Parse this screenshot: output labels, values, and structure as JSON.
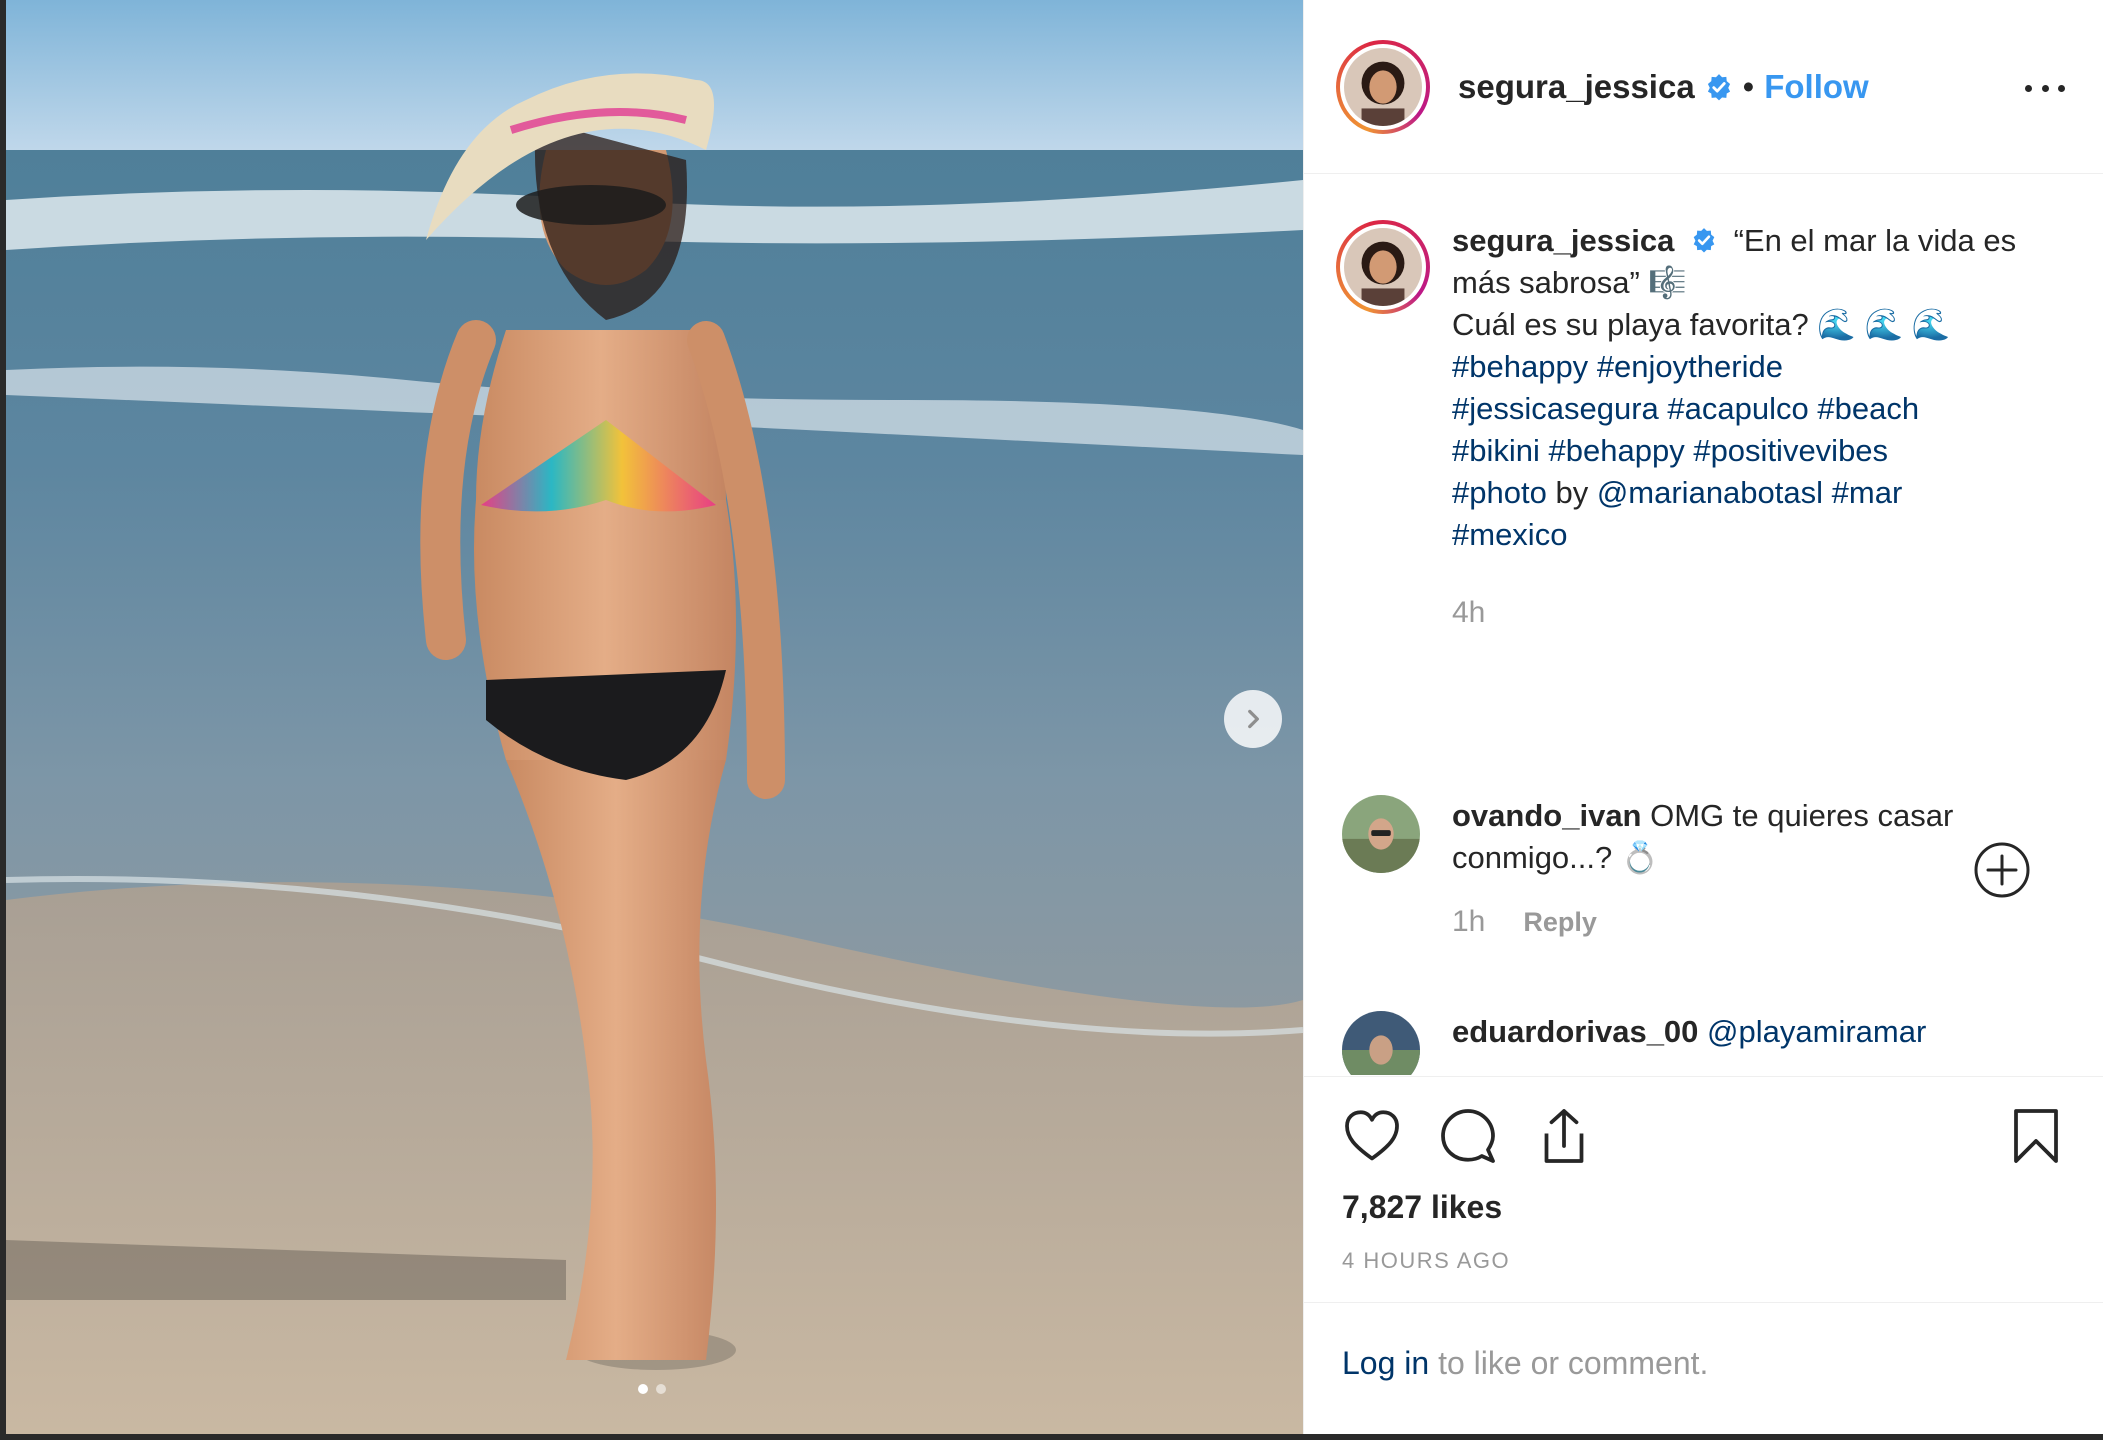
{
  "post": {
    "username": "segura_jessica",
    "separator": "•",
    "follow_label": "Follow",
    "carousel_index": 1,
    "carousel_total": 2
  },
  "caption": {
    "username": "segura_jessica",
    "text_1": "“En el mar la vida es más sabrosa” 🎼",
    "text_2": "Cuál es su playa favorita? 🌊 🌊 🌊",
    "h1": "#behappy",
    "h2": "#enjoytheride",
    "h3": "#jessicasegura",
    "h4": "#acapulco",
    "h5": "#beach",
    "h6": "#bikini",
    "h7": "#behappy",
    "h8": "#positivevibes",
    "h9": "#photo",
    "by": "by",
    "mention": "@marianabotasl",
    "h10": "#mar",
    "h11": "#mexico",
    "time": "4h"
  },
  "comments": [
    {
      "username": "ovando_ivan",
      "text": "OMG te quieres casar conmigo...? 💍",
      "time": "1h",
      "reply_label": "Reply"
    },
    {
      "username": "eduardorivas_00",
      "mention": "@playamiramar",
      "text": ""
    }
  ],
  "footer": {
    "likes": "7,827 likes",
    "ago": "4 HOURS AGO",
    "login_link": "Log in",
    "login_rest": " to like or comment."
  },
  "icons": {
    "like": "heart-icon",
    "comment": "comment-icon",
    "share": "share-icon",
    "save": "bookmark-icon",
    "more": "more-options-icon",
    "verified": "verified-badge-icon",
    "next": "chevron-right-icon",
    "load_more": "plus-circle-icon"
  },
  "colors": {
    "link_blue": "#3897f0",
    "hashtag": "#003569",
    "muted": "#999999",
    "verified": "#3897f0"
  }
}
